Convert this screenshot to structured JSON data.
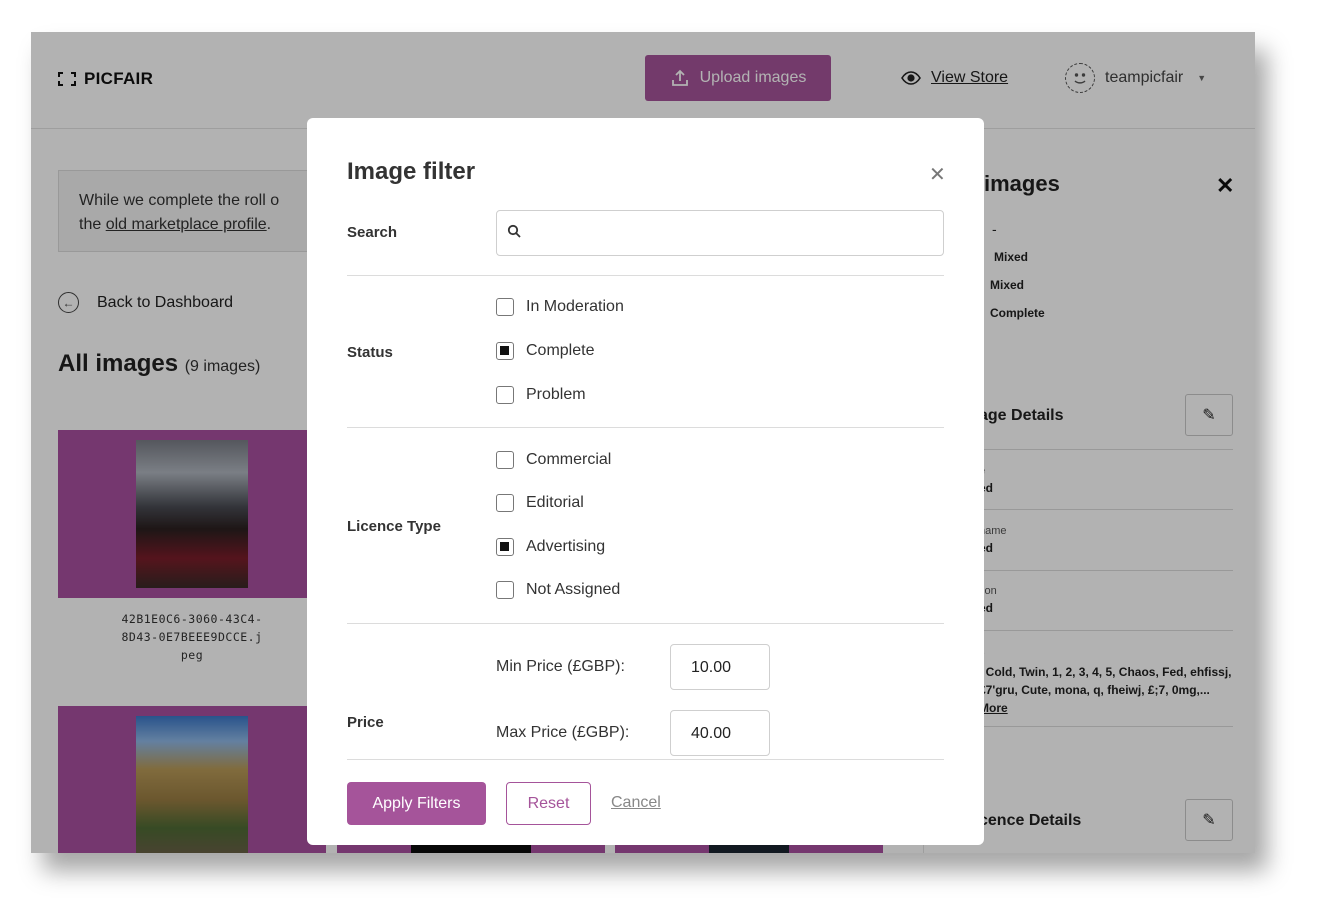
{
  "header": {
    "logo_text": "PICFAIR",
    "upload_label": "Upload images",
    "view_store_label": "View Store",
    "username": "teampicfair"
  },
  "notice": {
    "line1": "While we complete the roll o",
    "line2_prefix": "the ",
    "link": "old marketplace profile",
    "line2_suffix": "."
  },
  "back_label": "Back to Dashboard",
  "all_images": {
    "title": "All images",
    "count": "(9 images)"
  },
  "images": [
    {
      "filename_lines": [
        "42B1E0C6-3060-43C4-",
        "8D43-0E7BEEE9DCCE.j",
        "peg"
      ]
    }
  ],
  "right_panel": {
    "title": "images",
    "dash": "-",
    "values": [
      "Mixed",
      "Mixed",
      "Complete"
    ],
    "image_details_title": "age Details",
    "fields": [
      {
        "label": "e",
        "value": "ed"
      },
      {
        "label": "name",
        "value": "ed"
      },
      {
        "label": "tion",
        "value": "ed"
      },
      {
        "label": "s",
        "value": ""
      }
    ],
    "keywords": ", Cold, Twin, 1, 2, 3, 4, 5, Chaos, Fed, ehfissj, £7'gru, Cute, mona, q, fheiwj, £;7, 0mg,...",
    "more_label": "More",
    "licence_details_title": "cence Details"
  },
  "modal": {
    "title": "Image filter",
    "search_label": "Search",
    "search_value": "",
    "status_label": "Status",
    "status_options": [
      {
        "label": "In Moderation",
        "checked": false
      },
      {
        "label": "Complete",
        "checked": true
      },
      {
        "label": "Problem",
        "checked": false
      }
    ],
    "licence_label": "Licence Type",
    "licence_options": [
      {
        "label": "Commercial",
        "checked": false
      },
      {
        "label": "Editorial",
        "checked": false
      },
      {
        "label": "Advertising",
        "checked": true
      },
      {
        "label": "Not Assigned",
        "checked": false
      }
    ],
    "price_label": "Price",
    "min_price_label": "Min Price (£GBP):",
    "min_price_value": "10.00",
    "max_price_label": "Max Price (£GBP):",
    "max_price_value": "40.00",
    "apply_label": "Apply Filters",
    "reset_label": "Reset",
    "cancel_label": "Cancel"
  },
  "colors": {
    "accent": "#a5549a",
    "card_bg": "#a84fa0"
  }
}
